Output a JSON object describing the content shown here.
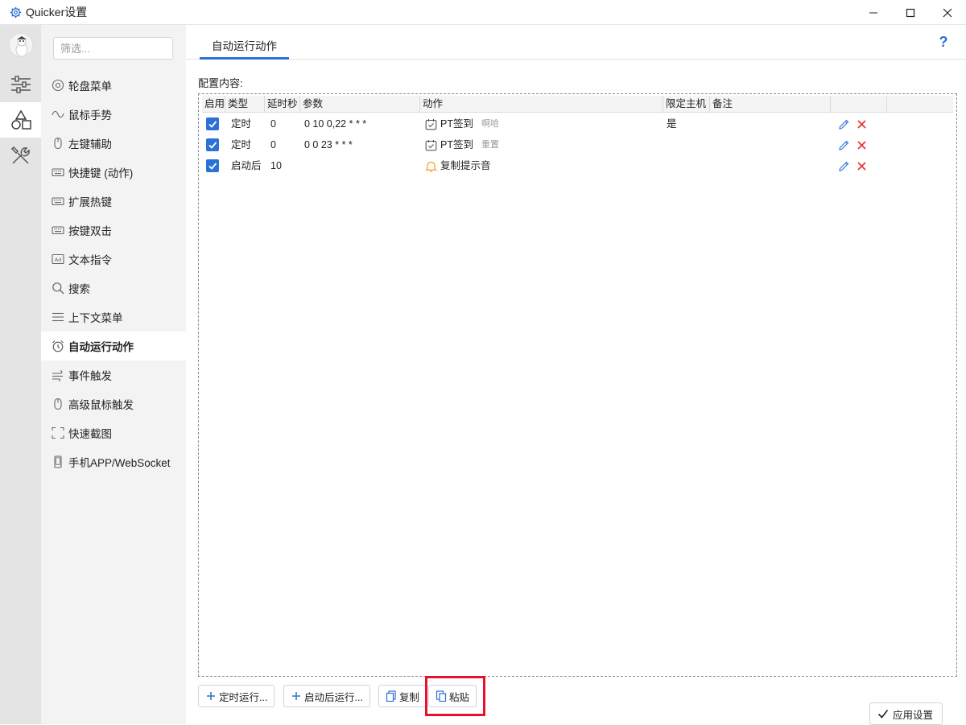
{
  "window": {
    "title": "Quicker设置"
  },
  "nav": {
    "search_placeholder": "筛选...",
    "items": [
      {
        "label": "轮盘菜单",
        "icon": "circle-menu-icon"
      },
      {
        "label": "鼠标手势",
        "icon": "wave-gesture-icon"
      },
      {
        "label": "左键辅助",
        "icon": "mouse-icon"
      },
      {
        "label": "快捷键 (动作)",
        "icon": "keyboard-icon"
      },
      {
        "label": "扩展热键",
        "icon": "keyboard-icon"
      },
      {
        "label": "按键双击",
        "icon": "keyboard-icon"
      },
      {
        "label": "文本指令",
        "icon": "ad-text-icon"
      },
      {
        "label": "搜索",
        "icon": "search-icon"
      },
      {
        "label": "上下文菜单",
        "icon": "hamburger-icon"
      },
      {
        "label": "自动运行动作",
        "icon": "alarm-clock-icon",
        "active": true
      },
      {
        "label": "事件触发",
        "icon": "wind-icon"
      },
      {
        "label": "高级鼠标触发",
        "icon": "mouse-icon"
      },
      {
        "label": "快速截图",
        "icon": "screenshot-icon"
      },
      {
        "label": "手机APP/WebSocket",
        "icon": "phone-icon"
      }
    ]
  },
  "main": {
    "tab": "自动运行动作",
    "help": "?",
    "config_label": "配置内容:",
    "columns": [
      "启用",
      "类型",
      "延时秒",
      "参数",
      "动作",
      "限定主机",
      "备注",
      "",
      ""
    ],
    "rows": [
      {
        "enabled": true,
        "type": "定时",
        "delay": "0",
        "params": "0 10 0,22 * * *",
        "action": "PT签到",
        "action_sub": "啊哈",
        "action_icon": "calendar-check-icon",
        "host": "是",
        "note": ""
      },
      {
        "enabled": true,
        "type": "定时",
        "delay": "0",
        "params": "0 0 23 * * *",
        "action": "PT签到",
        "action_sub": "重置",
        "action_icon": "calendar-check-icon",
        "host": "",
        "note": ""
      },
      {
        "enabled": true,
        "type": "启动后",
        "delay": "10",
        "params": "",
        "action": "复制提示音",
        "action_sub": "",
        "action_icon": "bell-icon",
        "host": "",
        "note": ""
      }
    ]
  },
  "toolbar": {
    "add_timer": "定时运行...",
    "add_startup": "启动后运行...",
    "copy": "复制",
    "paste": "粘贴",
    "apply": "应用设置"
  },
  "colors": {
    "accent": "#2b72d6",
    "delete": "#e53935",
    "highlight": "#e8102c",
    "warning": "#f0a020"
  }
}
